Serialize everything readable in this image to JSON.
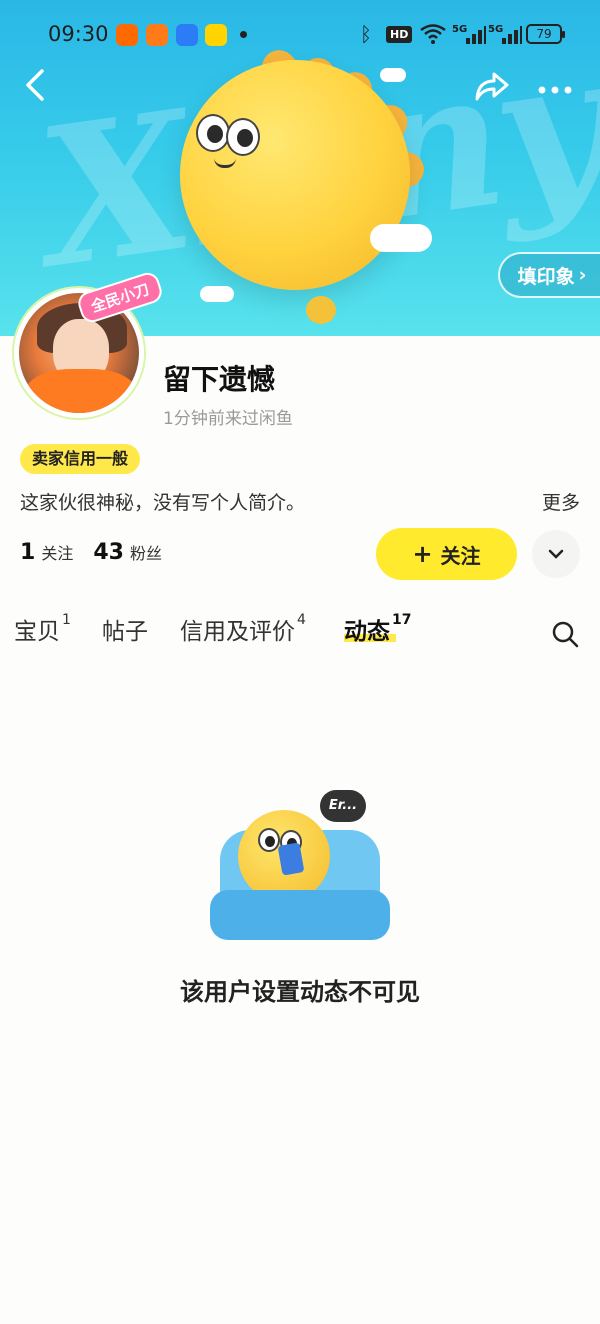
{
  "status_bar": {
    "time": "09:30",
    "apps": [
      "taobao-icon",
      "maps-icon",
      "meituan-icon"
    ],
    "bluetooth": "bluetooth-icon",
    "hd_label": "HD",
    "signal_1": "5G",
    "signal_2": "5G",
    "battery": "79"
  },
  "banner": {
    "watermark": "Xianyu"
  },
  "header": {
    "back_icon": "chevron-left-icon",
    "share_icon": "share-icon",
    "more_icon": "more-dots-icon",
    "impression_button": "填印象",
    "impression_arrow": "›"
  },
  "profile": {
    "avatar_tag": "全民小刀",
    "name": "留下遗憾",
    "last_seen": "1分钟前来过闲鱼",
    "credit_badge": "卖家信用一般",
    "bio": "这家伙很神秘，没有写个人简介。",
    "more": "更多",
    "following_count": "1",
    "following_label": "关注",
    "followers_count": "43",
    "followers_label": "粉丝",
    "follow_button": "关注",
    "follow_plus": "+"
  },
  "tabs": [
    {
      "label": "宝贝",
      "count": "1",
      "active": false
    },
    {
      "label": "帖子",
      "count": "",
      "active": false
    },
    {
      "label": "信用及评价",
      "count": "4",
      "active": false
    },
    {
      "label": "动态",
      "count": "17",
      "active": true
    }
  ],
  "empty_state": {
    "bubble": "Er...",
    "message": "该用户设置动态不可见"
  },
  "colors": {
    "accent_yellow": "#ffea2e",
    "banner_blue": "#2ab7e6",
    "badge_yellow": "#ffe94a"
  }
}
